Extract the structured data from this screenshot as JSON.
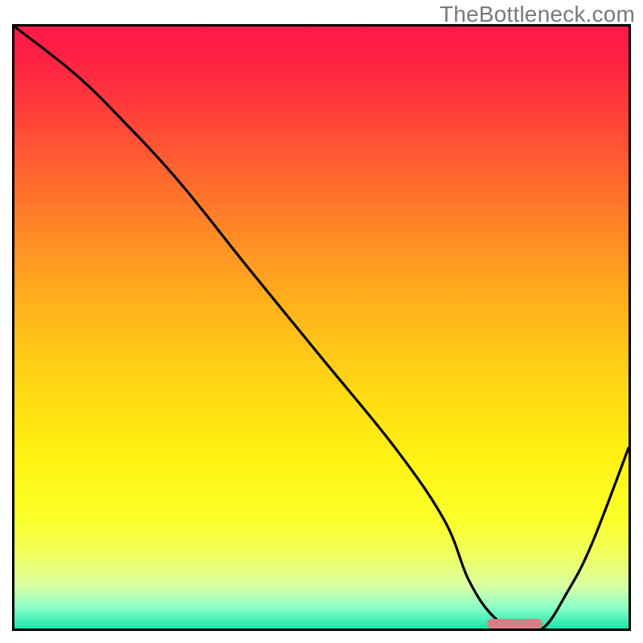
{
  "watermark": "TheBottleneck.com",
  "colors": {
    "border": "#000000",
    "curve": "#000000",
    "marker": "#d97e86",
    "watermark_text": "#7a7a7a",
    "gradient_stops": [
      {
        "offset": 0.0,
        "color": "#ff1948"
      },
      {
        "offset": 0.05,
        "color": "#ff2045"
      },
      {
        "offset": 0.15,
        "color": "#ff4239"
      },
      {
        "offset": 0.3,
        "color": "#ff7a2a"
      },
      {
        "offset": 0.45,
        "color": "#ffae1c"
      },
      {
        "offset": 0.6,
        "color": "#ffd813"
      },
      {
        "offset": 0.72,
        "color": "#fff312"
      },
      {
        "offset": 0.82,
        "color": "#fbff2a"
      },
      {
        "offset": 0.88,
        "color": "#f0ff60"
      },
      {
        "offset": 0.93,
        "color": "#d9ffa5"
      },
      {
        "offset": 0.965,
        "color": "#8affc9"
      },
      {
        "offset": 1.0,
        "color": "#18e6a8"
      }
    ]
  },
  "chart_data": {
    "type": "line",
    "title": "",
    "xlabel": "",
    "ylabel": "",
    "xlim": [
      0,
      100
    ],
    "ylim": [
      0,
      100
    ],
    "series": [
      {
        "name": "curve",
        "x": [
          0,
          10,
          18,
          27,
          38,
          50,
          62,
          70,
          74,
          78,
          82,
          86,
          90,
          94,
          100
        ],
        "y": [
          100,
          92,
          84,
          74,
          60,
          45,
          30,
          18,
          8,
          2,
          0,
          0,
          6,
          14,
          30
        ]
      }
    ],
    "annotations": [
      {
        "name": "optimal-range-marker",
        "type": "segment",
        "x0": 77,
        "x1": 86,
        "y": 0
      }
    ],
    "notes": "Background is a vertical heat gradient (top=red=worst, bottom=green=best). The curve shows bottleneck severity vs some x-axis parameter; minimum (optimal) occurs roughly at x≈77–86 where the pink marker sits. Values are estimated from pixel positions; axes carry no tick labels."
  }
}
